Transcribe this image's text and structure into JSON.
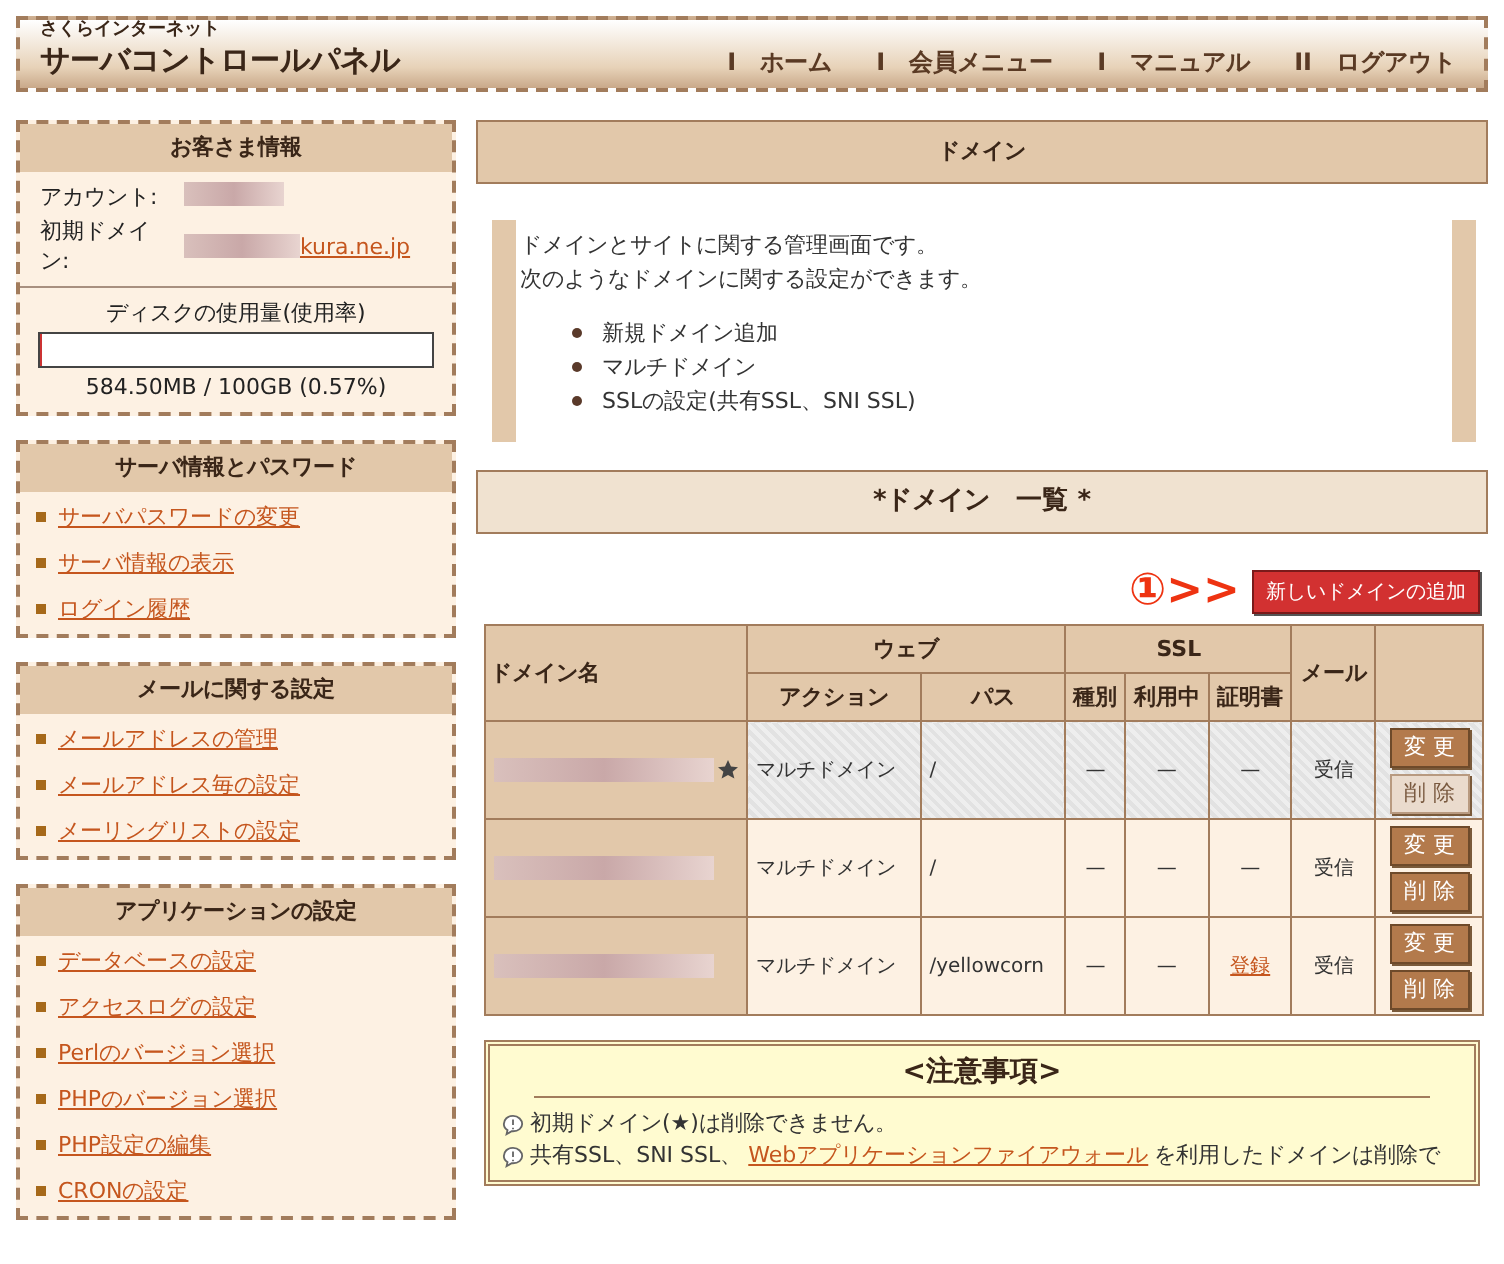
{
  "header": {
    "brand_small": "さくらインターネット",
    "brand": "サーバコントロールパネル",
    "nav": [
      {
        "label": "ホーム",
        "marker": "I"
      },
      {
        "label": "会員メニュー",
        "marker": "I"
      },
      {
        "label": "マニュアル",
        "marker": "I"
      },
      {
        "label": "ログアウト",
        "marker": "II"
      }
    ]
  },
  "customer": {
    "title": "お客さま情報",
    "account_label": "アカウント:",
    "domain_label": "初期ドメイン:",
    "domain_tail": "kura.ne.jp",
    "disk_title": "ディスクの使用量(使用率)",
    "disk_meter": {
      "level": 0.0057
    },
    "disk_reading": "584.50MB / 100GB (0.57%)"
  },
  "menus": [
    {
      "title": "サーバ情報とパスワード",
      "items": [
        "サーバパスワードの変更",
        "サーバ情報の表示",
        "ログイン履歴"
      ]
    },
    {
      "title": "メールに関する設定",
      "items": [
        "メールアドレスの管理",
        "メールアドレス毎の設定",
        "メーリングリストの設定"
      ]
    },
    {
      "title": "アプリケーションの設定",
      "items": [
        "データベースの設定",
        "アクセスログの設定",
        "Perlのバージョン選択",
        "PHPのバージョン選択",
        "PHP設定の編集",
        "CRONの設定"
      ]
    }
  ],
  "main": {
    "title": "ドメイン",
    "intro": [
      "ドメインとサイトに関する管理画面です。",
      "次のようなドメインに関する設定ができます。"
    ],
    "features": [
      "新規ドメイン追加",
      "マルチドメイン",
      "SSLの設定(共有SSL、SNI SSL)"
    ],
    "list_title": "*ドメイン　一覧 *",
    "annotation": "①>>",
    "add_button": "新しいドメインの追加"
  },
  "table": {
    "columns": {
      "domain": "ドメイン名",
      "web": "ウェブ",
      "action": "アクション",
      "path": "パス",
      "ssl": "SSL",
      "type": "種別",
      "in_use": "利用中",
      "cert": "証明書",
      "mail": "メール"
    },
    "rows": [
      {
        "initial": true,
        "action": "マルチドメイン",
        "path": "/",
        "type": "—",
        "in_use": "—",
        "cert": {
          "text": "—",
          "link": false
        },
        "mail": "受信",
        "edit": {
          "label": "変 更",
          "disabled": false
        },
        "delete": {
          "label": "削 除",
          "disabled": true
        }
      },
      {
        "initial": false,
        "action": "マルチドメイン",
        "path": "/",
        "type": "—",
        "in_use": "—",
        "cert": {
          "text": "—",
          "link": false
        },
        "mail": "受信",
        "edit": {
          "label": "変 更",
          "disabled": false
        },
        "delete": {
          "label": "削 除",
          "disabled": false
        }
      },
      {
        "initial": false,
        "action": "マルチドメイン",
        "path": "/yellowcorn",
        "type": "—",
        "in_use": "—",
        "cert": {
          "text": "登録",
          "link": true
        },
        "mail": "受信",
        "edit": {
          "label": "変 更",
          "disabled": false
        },
        "delete": {
          "label": "削 除",
          "disabled": false
        }
      }
    ]
  },
  "notes": {
    "title": "<注意事項>",
    "items": [
      {
        "parts": [
          {
            "text": "初期ドメイン(★)は削除できません。",
            "link": false
          }
        ]
      },
      {
        "parts": [
          {
            "text": "共有SSL、SNI SSL、",
            "link": false
          },
          {
            "text": "Webアプリケーションファイアウォール",
            "link": true
          },
          {
            "text": "を利用したドメインは削除で",
            "link": false
          }
        ]
      }
    ]
  }
}
